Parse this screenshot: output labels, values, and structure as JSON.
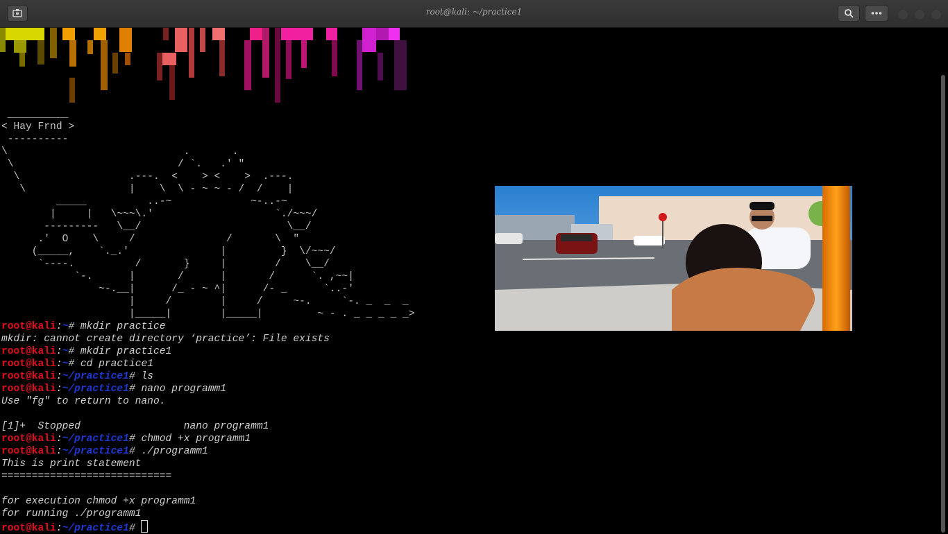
{
  "window": {
    "title": "root@kali: ~/practice1"
  },
  "icons": {
    "new_tab": "terminal-tab-icon",
    "search": "search-icon",
    "menu": "more-options-icon"
  },
  "colors": {
    "prompt_user": "#e30f1f",
    "prompt_path": "#1d39d6",
    "background": "#000000"
  },
  "ascii": {
    "bubble_top": " __________",
    "bubble_text": "< Hay Frnd >",
    "bubble_bottom": " ----------",
    "art": "\\                             .       .\n \\                           / `.   .' \"\n  \\                  .---.  <    > <    >  .---.\n   \\                 |    \\  \\ - ~ ~ - /  /    |\n         _____          ..-~             ~-..-~\n        |     |   \\~~~\\.'                    `./~~~/\n       ---------   \\__/                        \\__/\n      .'  O    \\     /               /       \\  \"\n     (_____,    `._.'               |         }  \\/~~~/\n      `----.          /       }     |        /    \\__/\n            `-.      |       /      |       /      `. ,~~|\n                ~-.__|      /_ - ~ ^|      /- _      `..-'\n                     |     /        |     /     ~-.     `-. _  _  _\n                     |_____|        |_____|         ~ - . _ _ _ _ _>"
  },
  "prompt": {
    "user": "root@kali",
    "sep": ":",
    "home": "~",
    "dir": "~/practice1",
    "hash": "#"
  },
  "lines": {
    "cmd1": " mkdir practice",
    "out1": "mkdir: cannot create directory ‘practice’: File exists",
    "cmd2": " mkdir practice1",
    "cmd3": " cd practice1",
    "cmd4": " ls",
    "cmd5": " nano programm1",
    "out5": "Use \"fg\" to return to nano.",
    "job": "[1]+  Stopped                 nano programm1",
    "cmd6": " chmod +x programm1",
    "cmd7": " ./programm1",
    "out7a": "This is print statement",
    "out7b": "============================",
    "out7c": "for execution chmod +x programm1",
    "out7d": "for running ./programm1"
  }
}
